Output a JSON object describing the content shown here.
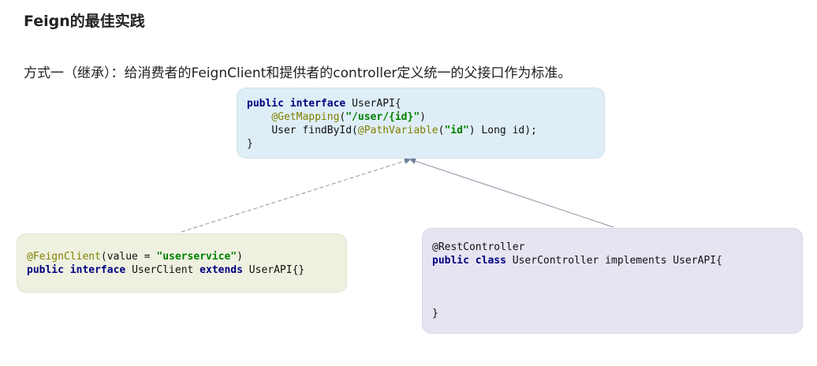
{
  "page": {
    "title": "Feign的最佳实践",
    "subtitle": "方式一（继承）：给消费者的FeignClient和提供者的controller定义统一的父接口作为标准。"
  },
  "api_box": {
    "line1": {
      "kw1": "public",
      "kw2": "interface",
      "rest": " UserAPI{"
    },
    "line2": {
      "ann": "@GetMapping",
      "open": "(",
      "str": "\"/user/{id}\"",
      "close": ")"
    },
    "line3": {
      "pre": "User findById(",
      "ann": "@PathVariable",
      "open": "(",
      "str": "\"id\"",
      "post": ") Long id);"
    },
    "line4": "}"
  },
  "client_box": {
    "line1": {
      "ann": "@FeignClient",
      "pre": "(value = ",
      "str": "\"userservice\"",
      "post": ")"
    },
    "line2": {
      "kw1": "public",
      "kw2": "interface",
      "mid": " UserClient ",
      "kw3": "extends",
      "rest": " UserAPI{}"
    }
  },
  "controller_box": {
    "line1": "@RestController",
    "line2": {
      "kw1": "public",
      "kw2": "class",
      "rest": " UserController implements UserAPI{"
    },
    "line3": "}"
  },
  "colors": {
    "keyword": "#000080",
    "annotation": "#808000",
    "string": "#008000",
    "api_bg": "#dfeef6",
    "client_bg": "#eef1e0",
    "controller_bg": "#e7e4f1",
    "arrow": "#6f7f99"
  }
}
